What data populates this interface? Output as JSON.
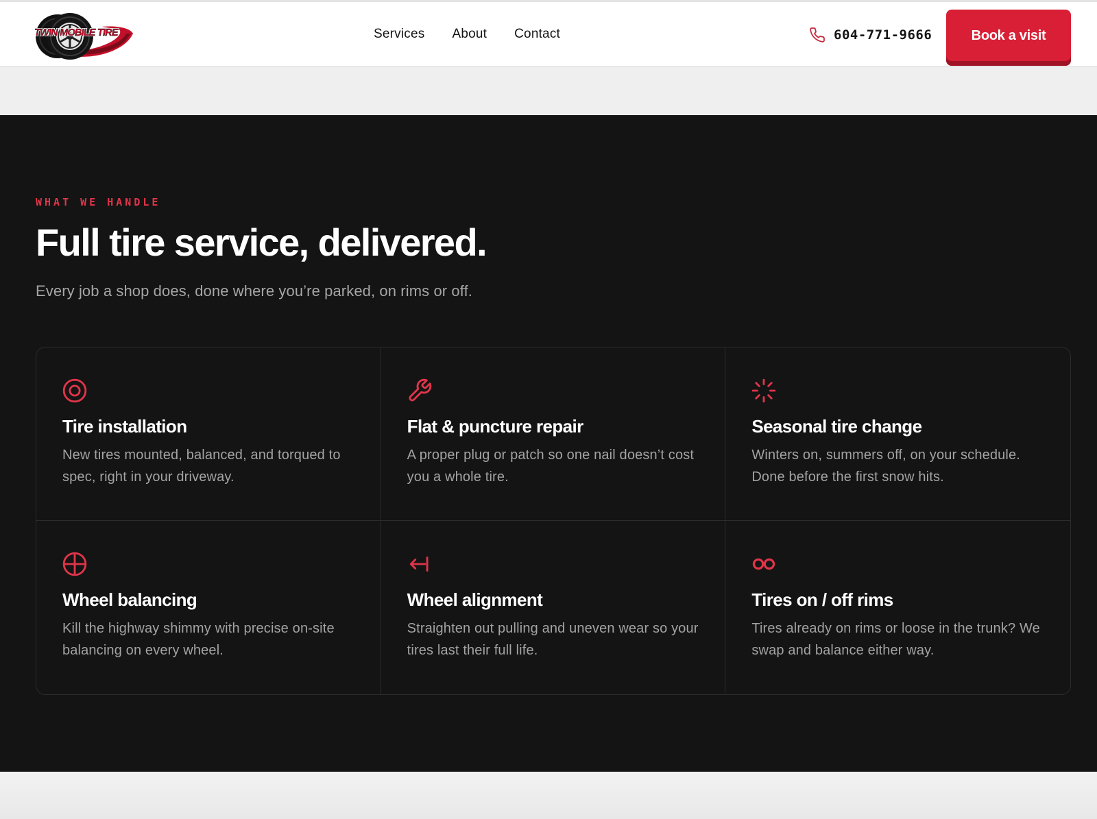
{
  "brand": {
    "logo_text": "TWIN MOBILE TIRE",
    "accent_color": "#d81f35"
  },
  "nav": {
    "items": [
      {
        "label": "Services"
      },
      {
        "label": "About"
      },
      {
        "label": "Contact"
      }
    ]
  },
  "header": {
    "phone_icon": "phone-icon",
    "phone": "604-771-9666",
    "cta_label": "Book a visit"
  },
  "services": {
    "eyebrow": "WHAT WE HANDLE",
    "title": "Full tire service, delivered.",
    "subtitle": "Every job a shop does, done where you’re parked, on rims or off.",
    "items": [
      {
        "icon": "target-icon",
        "title": "Tire installation",
        "desc": "New tires mounted, balanced, and torqued to spec, right in your driveway."
      },
      {
        "icon": "wrench-icon",
        "title": "Flat & puncture repair",
        "desc": "A proper plug or patch so one nail doesn’t cost you a whole tire."
      },
      {
        "icon": "loader-icon",
        "title": "Seasonal tire change",
        "desc": "Winters on, summers off, on your schedule. Done before the first snow hits."
      },
      {
        "icon": "crosshair-icon",
        "title": "Wheel balancing",
        "desc": "Kill the highway shimmy with precise on-site balancing on every wheel."
      },
      {
        "icon": "arrow-left-to-line-icon",
        "title": "Wheel alignment",
        "desc": "Straighten out pulling and uneven wear so your tires last their full life."
      },
      {
        "icon": "infinity-icon",
        "title": "Tires on / off rims",
        "desc": "Tires already on rims or loose in the trunk? We swap and balance either way."
      }
    ]
  }
}
